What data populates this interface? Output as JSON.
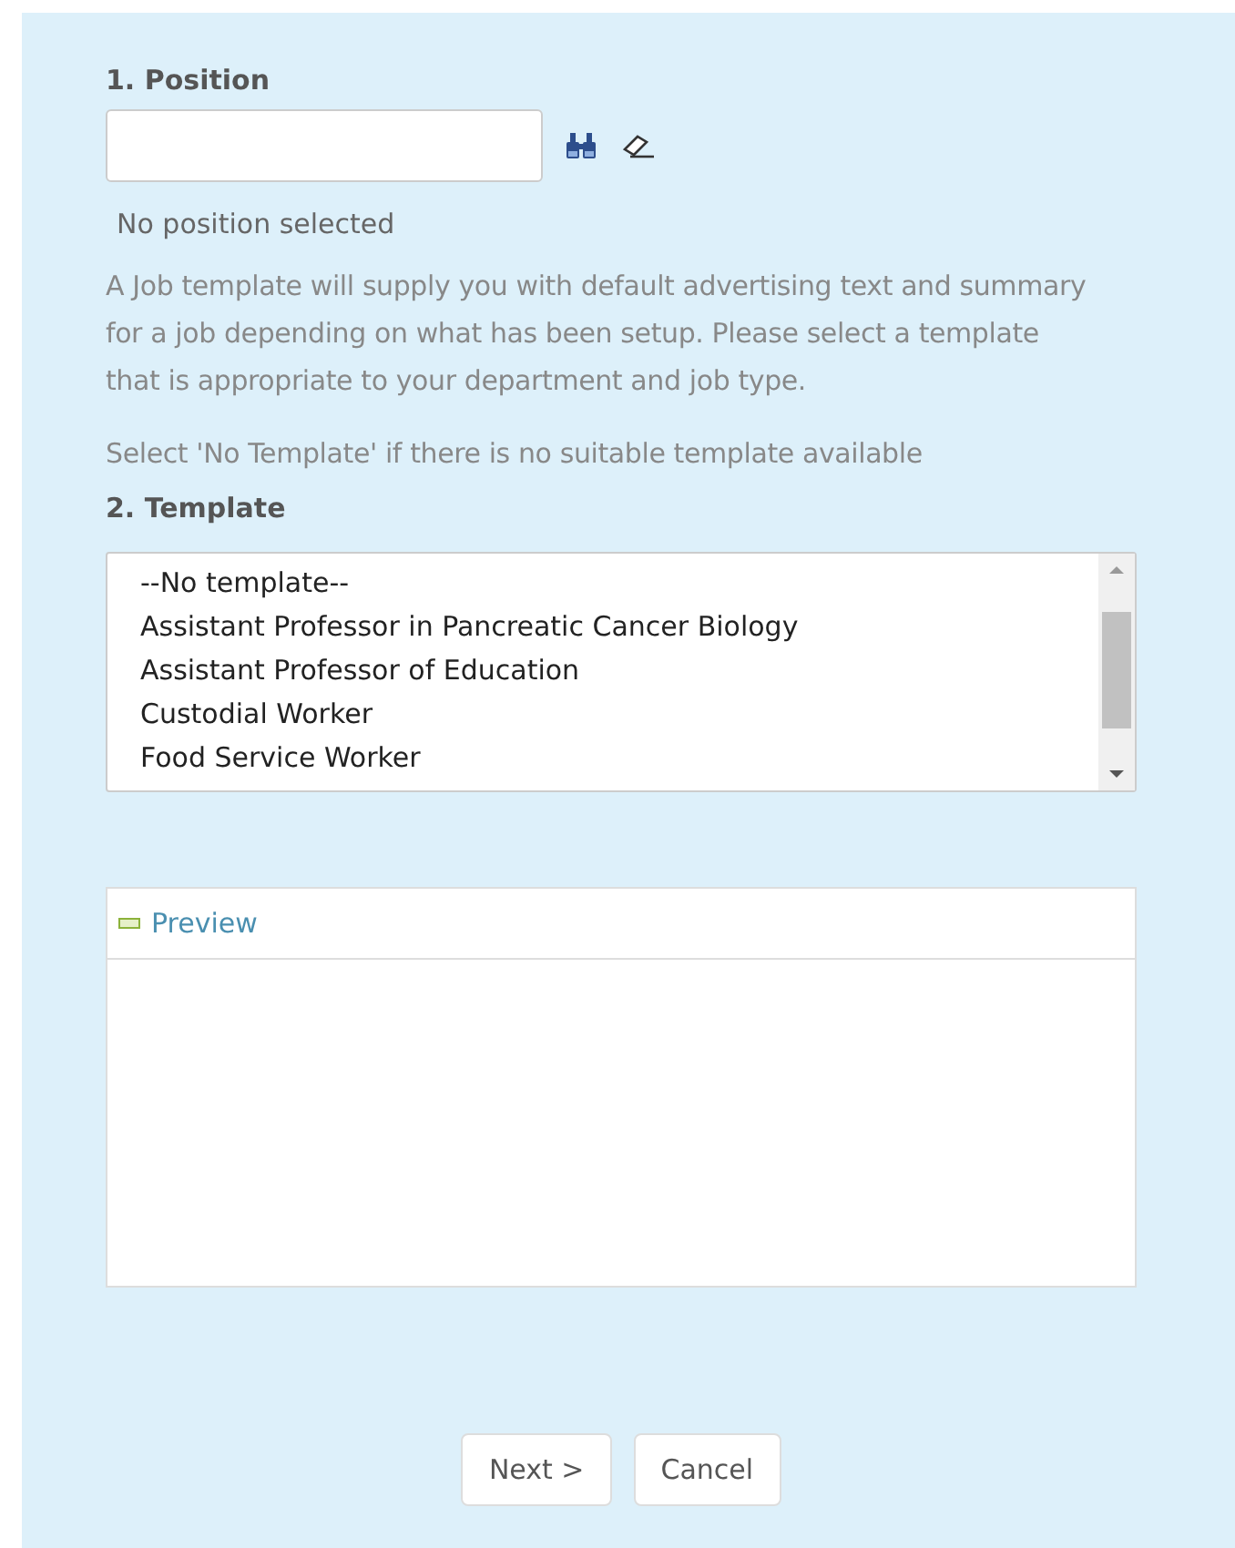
{
  "position": {
    "label": "1. Position",
    "status": "No position selected"
  },
  "intro": "A Job template will supply you with default advertising text and summary for a job depending on what has been setup. Please select a template that is appropriate to your department and job type.",
  "hint": "Select 'No Template' if there is no suitable template available",
  "template": {
    "label": "2. Template",
    "options": [
      "--No template--",
      "Assistant Professor in Pancreatic Cancer Biology",
      "Assistant Professor of Education",
      "Custodial Worker",
      "Food Service Worker"
    ]
  },
  "preview": {
    "title": "Preview",
    "expanded": true
  },
  "buttons": [
    "Next >",
    "Cancel"
  ]
}
